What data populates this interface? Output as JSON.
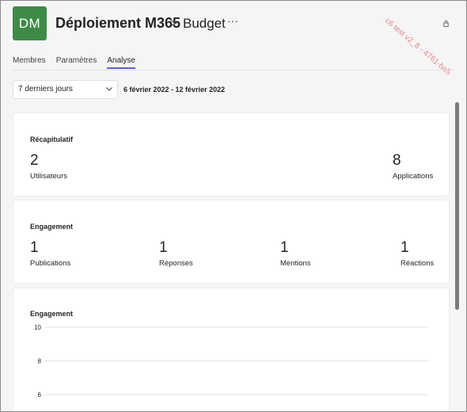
{
  "header": {
    "avatar_initials": "DM",
    "team_name": "Déploiement M365",
    "separator": ">",
    "channel_name": "Budget",
    "more_label": "···",
    "watermark": "c6 test v2_8 - 4761-ba5"
  },
  "tabs": [
    {
      "label": "Membres",
      "active": false
    },
    {
      "label": "Paramètres",
      "active": false
    },
    {
      "label": "Analyse",
      "active": true
    }
  ],
  "filter": {
    "period_value": "7 derniers jours",
    "date_range": "6 février 2022 - 12 février 2022"
  },
  "summary": {
    "title": "Récapitulatif",
    "users_value": "2",
    "users_label": "Utilisateurs",
    "apps_value": "8",
    "apps_label": "Applications"
  },
  "engagement": {
    "title": "Engagement",
    "metrics": [
      {
        "value": "1",
        "label": "Publications"
      },
      {
        "value": "1",
        "label": "Réponses"
      },
      {
        "value": "1",
        "label": "Mentions"
      },
      {
        "value": "1",
        "label": "Réactions"
      }
    ]
  },
  "engagement_chart": {
    "title": "Engagement"
  },
  "chart_data": {
    "type": "line",
    "title": "Engagement",
    "yticks": [
      10,
      8,
      6
    ],
    "ylim": [
      6,
      10
    ],
    "grid": true,
    "series": []
  },
  "colors": {
    "avatar_bg": "#3f8a47",
    "tab_accent": "#5b5fc7",
    "watermark": "#e07b7b"
  }
}
